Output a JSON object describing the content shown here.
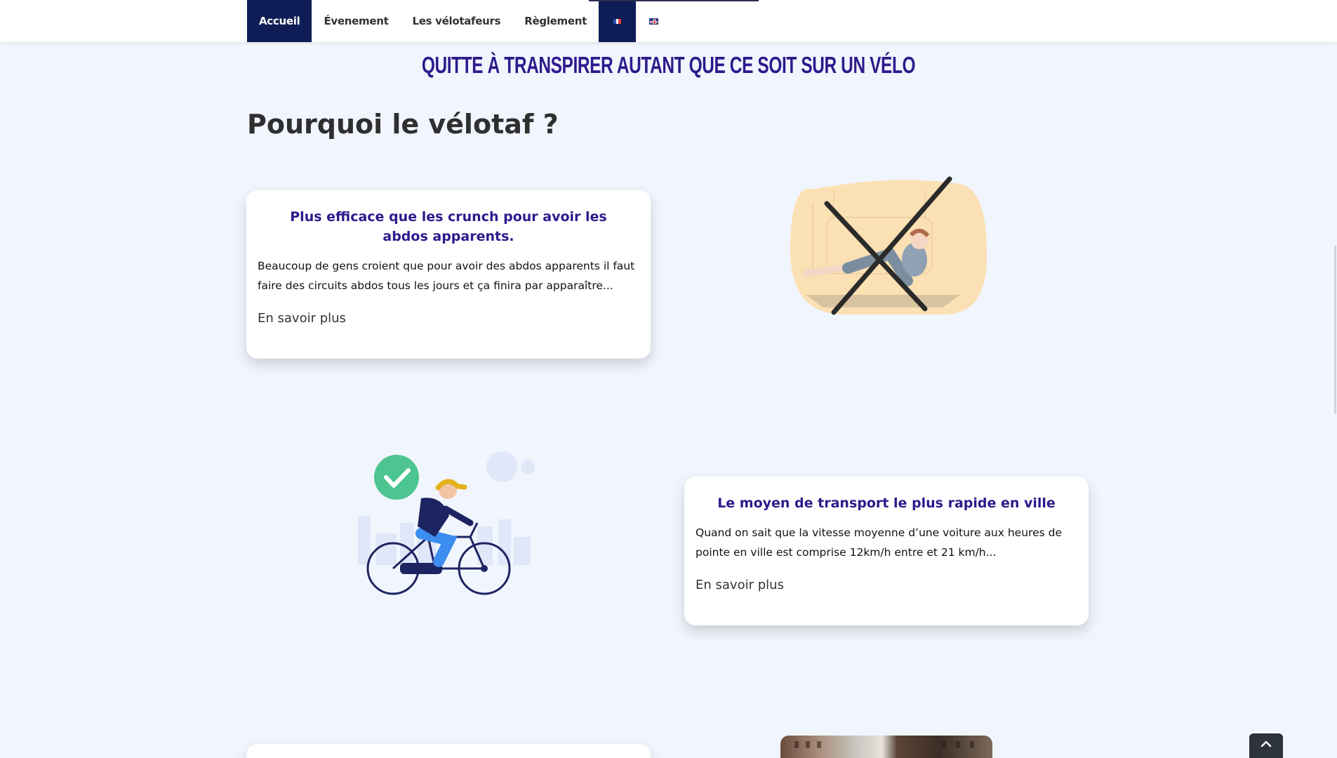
{
  "nav": {
    "items": [
      {
        "label": "Accueil"
      },
      {
        "label": "Évenement"
      },
      {
        "label": "Les vélotafeurs"
      },
      {
        "label": "Règlement"
      }
    ]
  },
  "tagline": "QUITTE À TRANSPIRER AUTANT QUE CE SOIT SUR UN VÉLO",
  "section_title": "Pourquoi le vélotaf ?",
  "cards": [
    {
      "title": "Plus efficace que les crunch pour avoir les abdos apparents.",
      "text": "Beaucoup de gens croient que pour avoir des abdos apparents il faut faire des circuits abdos tous les jours et ça finira par apparaître...",
      "link": "En savoir plus"
    },
    {
      "title": "Le moyen de transport le plus rapide en ville",
      "text": "Quand on sait que la vitesse moyenne d’une voiture aux heures de pointe en ville est comprise 12km/h entre et 21 km/h...",
      "link": "En savoir plus"
    }
  ],
  "colors": {
    "nav_active": "#0e1d55",
    "title_purple": "#2d1a8c",
    "page_bg": "#f1f5fd",
    "check_green": "#4dc591"
  }
}
